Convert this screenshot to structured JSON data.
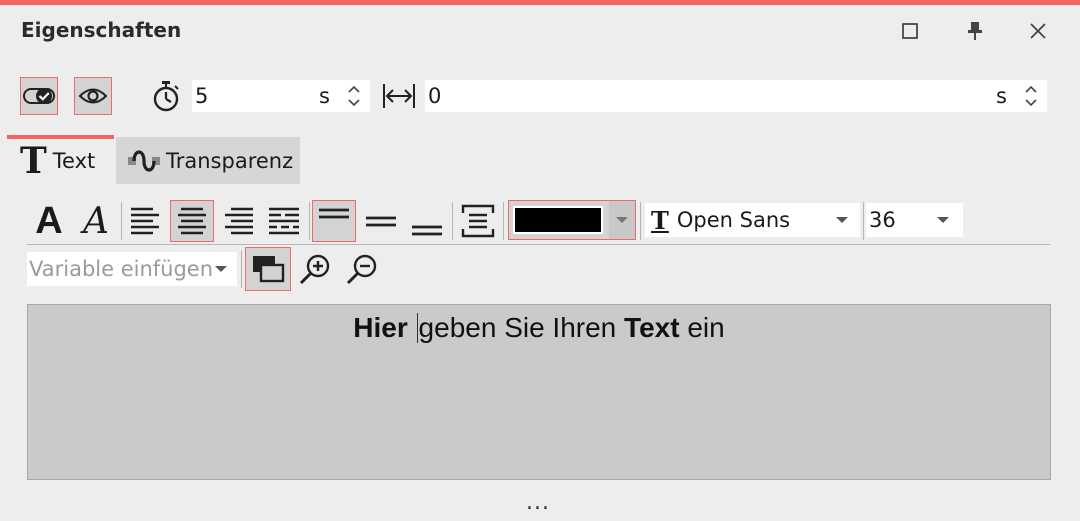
{
  "window": {
    "title": "Eigenschaften",
    "accent": "#f06464"
  },
  "window_buttons": [
    "maximize-icon",
    "pin-icon",
    "close-icon"
  ],
  "timing": {
    "duration": {
      "value": "5",
      "unit": "s"
    },
    "gap": {
      "value": "0",
      "unit": "s"
    }
  },
  "tabs": [
    {
      "label": "Text",
      "glyph": "T",
      "active": true
    },
    {
      "label": "Transparenz",
      "active": false
    }
  ],
  "toolbar": {
    "bold_glyph": "A",
    "italic_glyph": "A",
    "alignment": "center",
    "vertical_alignment": "top",
    "text_color": "#000000",
    "font": {
      "glyph": "T",
      "name": "Open Sans"
    },
    "size": "36"
  },
  "variable": {
    "placeholder": "Variable einfügen"
  },
  "editor": {
    "parts": [
      {
        "text": "Hier",
        "bold": true
      },
      {
        "text": " "
      },
      {
        "text": "geben Sie Ihren ",
        "bold": false
      },
      {
        "text": "Text",
        "bold": true
      },
      {
        "text": " ein",
        "bold": false
      }
    ]
  },
  "footer": {
    "more": "..."
  }
}
